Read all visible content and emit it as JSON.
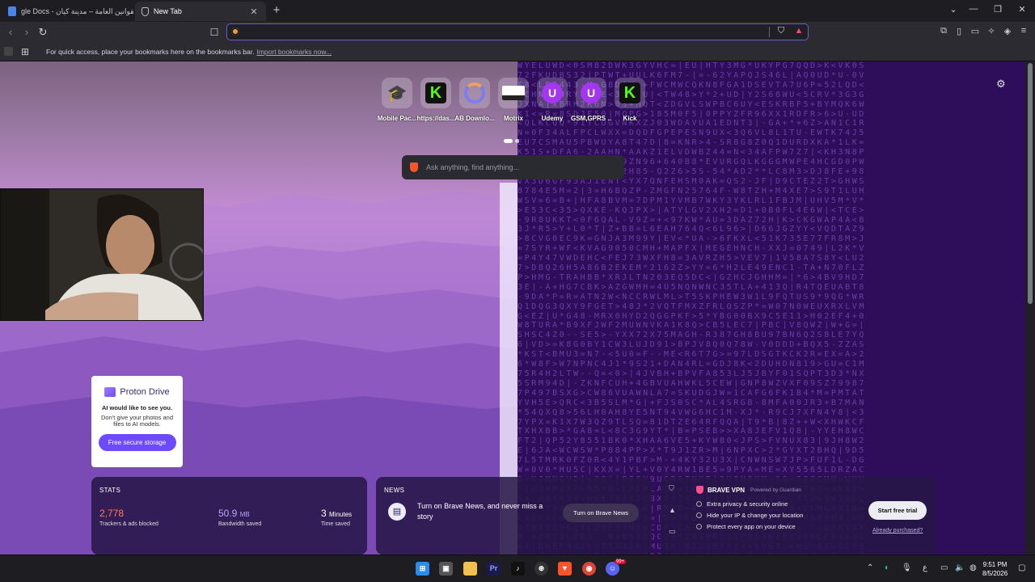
{
  "tabs": [
    {
      "label": "gle Docs - القوانين العامة – مدينة كيان",
      "active": false
    },
    {
      "label": "New Tab",
      "active": true
    }
  ],
  "toolbar": {
    "url_value": "",
    "url_placeholder": ""
  },
  "bookmarks_bar": {
    "hint": "For quick access, place your bookmarks here on the bookmarks bar.",
    "import_link": "Import bookmarks now..."
  },
  "top_sites": [
    {
      "name": "Mobile Pac...",
      "icon": "graduation-cap-icon"
    },
    {
      "name": "https://das...",
      "icon": "kick-icon"
    },
    {
      "name": "AB Downlo...",
      "icon": "ab-download-icon"
    },
    {
      "name": "Motrix",
      "icon": "motrix-icon"
    },
    {
      "name": "Udemy",
      "icon": "udemy-icon"
    },
    {
      "name": "GSM,GPRS ...",
      "icon": "udemy-icon"
    },
    {
      "name": "Kick",
      "icon": "kick-icon"
    }
  ],
  "search": {
    "placeholder": "Ask anything, find anything..."
  },
  "proton": {
    "brand": "Proton Drive",
    "headline": "AI would like to see you.",
    "body": "Don't give your photos and files to AI models.",
    "cta": "Free secure storage"
  },
  "stats": {
    "title": "STATS",
    "items": [
      {
        "value": "2,778",
        "unit": "",
        "label": "Trackers & ads blocked",
        "color": "#ff7b5c"
      },
      {
        "value": "50.9",
        "unit": "MB",
        "label": "Bandwidth saved",
        "color": "#b9a6ff"
      },
      {
        "value": "3",
        "unit": "Minutes",
        "label": "Time saved",
        "color": "#ffffff"
      }
    ]
  },
  "news": {
    "title": "NEWS",
    "text": "Turn on Brave News, and never miss a story",
    "button": "Turn on Brave News"
  },
  "vpn": {
    "title": "BRAVE VPN",
    "powered": "Powered by Guardian",
    "features": [
      "Extra privacy & security online",
      "Hide your IP & change your location",
      "Protect every app on your device"
    ],
    "button": "Start free trial",
    "link": "Already purchased?"
  },
  "taskbar": {
    "lang": "ع",
    "time": "9:51 PM",
    "date": "8/5/2026",
    "notif_badge": "99+"
  },
  "colors": {
    "accent": "#6d5bd0",
    "brave_orange": "#fb542b",
    "proton_purple": "#6d4aff"
  }
}
